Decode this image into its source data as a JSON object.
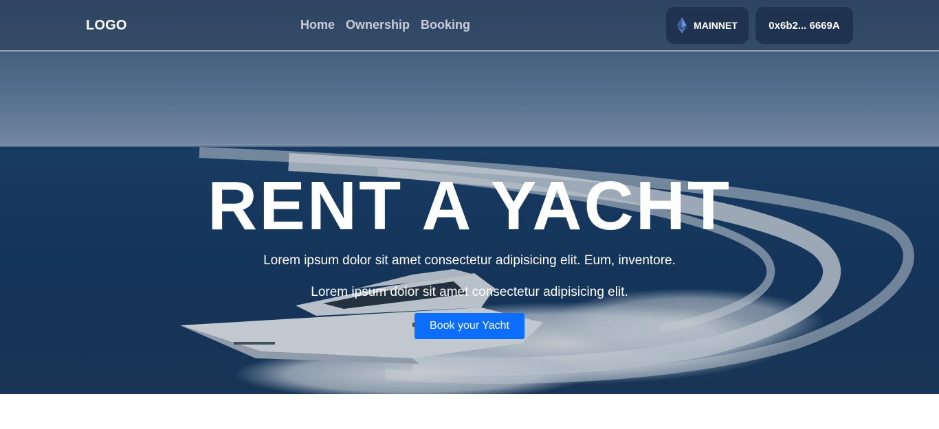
{
  "navbar": {
    "logo": "LOGO",
    "links": [
      "Home",
      "Ownership",
      "Booking"
    ],
    "network": {
      "label": "MAINNET",
      "icon": "ethereum-icon"
    },
    "wallet": {
      "address": "0x6b2... 6669A"
    }
  },
  "hero": {
    "title": "RENT A YACHT",
    "subtitle_1": "Lorem ipsum dolor sit amet consectetur adipisicing elit. Eum, inventore.",
    "subtitle_2": "Lorem ipsum dolor sit amet consectetur adipisicing elit.",
    "cta_label": "Book your Yacht"
  },
  "colors": {
    "accent": "#0d6efd",
    "nav_button_bg": "#1f3350",
    "sea": "#173a63",
    "sky": "#5f7fa3"
  }
}
